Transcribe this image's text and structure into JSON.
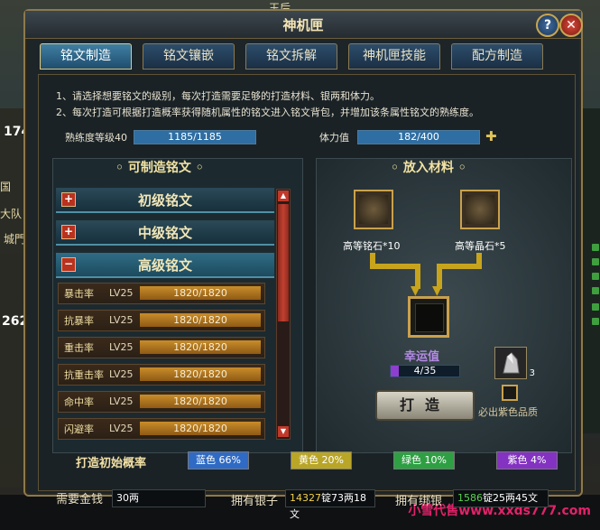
{
  "window": {
    "title": "神机匣"
  },
  "tabs": [
    {
      "label": "铭文制造"
    },
    {
      "label": "铭文镶嵌"
    },
    {
      "label": "铭文拆解"
    },
    {
      "label": "神机匣技能"
    },
    {
      "label": "配方制造"
    }
  ],
  "description": [
    "1、请选择想要铭文的级别，每次打造需要足够的打造材料、银两和体力。",
    "2、每次打造可根据打造概率获得随机属性的铭文进入铭文背包，并增加该条属性铭文的熟练度。"
  ],
  "proficiency": {
    "label": "熟练度等级40",
    "value": "1185/1185"
  },
  "stamina": {
    "label": "体力值",
    "value": "182/400"
  },
  "left_panel": {
    "title": "可制造铭文",
    "categories": [
      {
        "label": "初级铭文",
        "toggle": "+"
      },
      {
        "label": "中级铭文",
        "toggle": "+"
      },
      {
        "label": "高级铭文",
        "toggle": "−"
      }
    ],
    "items": [
      {
        "name": "暴击率",
        "level": "LV25",
        "progress": "1820/1820"
      },
      {
        "name": "抗暴率",
        "level": "LV25",
        "progress": "1820/1820"
      },
      {
        "name": "重击率",
        "level": "LV25",
        "progress": "1820/1820"
      },
      {
        "name": "抗重击率",
        "level": "LV25",
        "progress": "1820/1820"
      },
      {
        "name": "命中率",
        "level": "LV25",
        "progress": "1820/1820"
      },
      {
        "name": "闪避率",
        "level": "LV25",
        "progress": "1820/1820"
      }
    ]
  },
  "right_panel": {
    "title": "放入材料",
    "materials": [
      {
        "label": "高等铭石*10"
      },
      {
        "label": "高等晶石*5"
      }
    ],
    "luck": {
      "label": "幸运值",
      "value": "4/35",
      "fill_fraction": 0.114
    },
    "crystal_count": "3",
    "craft_button": "打造",
    "must_purple": "必出紫色品质"
  },
  "probabilities": {
    "label": "打造初始概率",
    "items": [
      {
        "text": "蓝色 66%",
        "color": "#2f6bc4"
      },
      {
        "text": "黄色 20%",
        "color": "#b9a627"
      },
      {
        "text": "绿色 10%",
        "color": "#2ea043"
      },
      {
        "text": "紫色 4%",
        "color": "#8432c2"
      }
    ]
  },
  "money": {
    "cost_label": "需要金钱",
    "cost_value": "30两",
    "silver_label": "拥有银子",
    "silver_amount": "14327",
    "silver_rest": "锭73两18文",
    "bound_label": "拥有绑银",
    "bound_amount": "1586",
    "bound_rest": "锭25两45文"
  },
  "background": {
    "top_name": "玉后",
    "left_num1": "174",
    "left_num2": "262",
    "left_text1": "国",
    "left_text2": "大队",
    "left_text3": "城門",
    "watermark": "小雪代售www.xxds777.com"
  }
}
